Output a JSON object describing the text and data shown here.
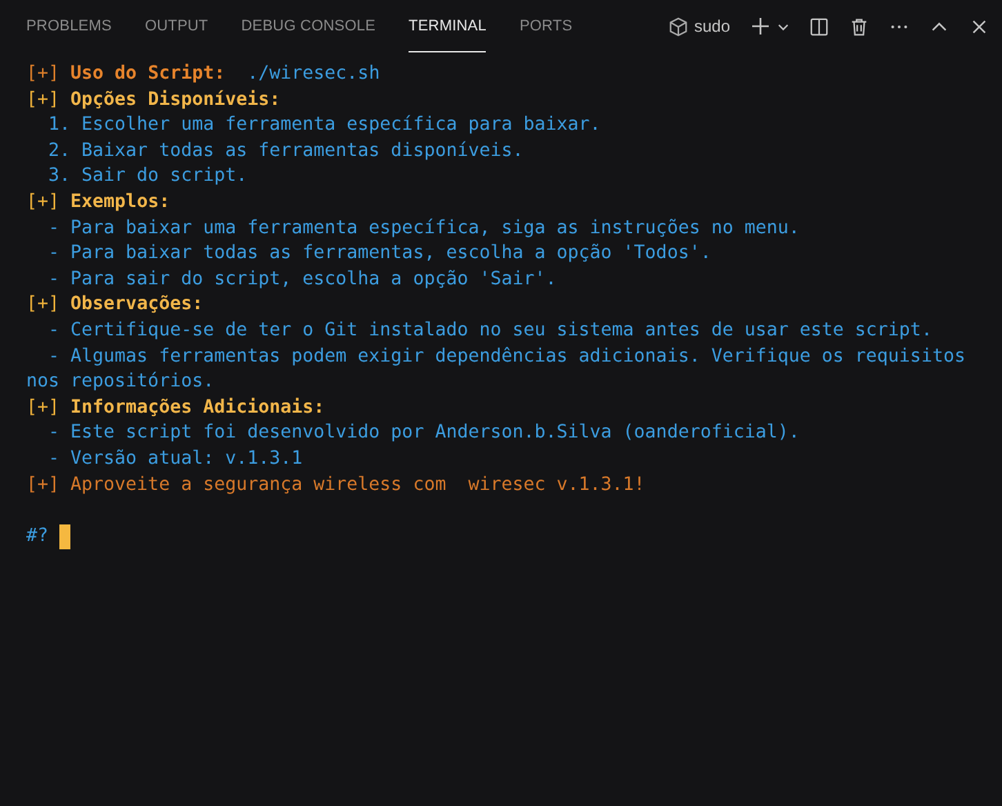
{
  "tabs": [
    {
      "label": "PROBLEMS",
      "selected": false
    },
    {
      "label": "OUTPUT",
      "selected": false
    },
    {
      "label": "DEBUG CONSOLE",
      "selected": false
    },
    {
      "label": "TERMINAL",
      "selected": true
    },
    {
      "label": "PORTS",
      "selected": false
    }
  ],
  "terminal_instance": {
    "name": "sudo"
  },
  "terminal": {
    "lines": [
      {
        "segments": [
          {
            "text": "[+] ",
            "kind": "marker-orange"
          },
          {
            "text": "Uso do Script: ",
            "kind": "title"
          },
          {
            "text": " ./wiresec.sh",
            "kind": "body"
          }
        ]
      },
      {
        "segments": [
          {
            "text": "[+] ",
            "kind": "marker"
          },
          {
            "text": "Opções Disponíveis:",
            "kind": "heading"
          }
        ]
      },
      {
        "segments": [
          {
            "text": "  1. Escolher uma ferramenta específica para baixar.",
            "kind": "body"
          }
        ]
      },
      {
        "segments": [
          {
            "text": "  2. Baixar todas as ferramentas disponíveis.",
            "kind": "body"
          }
        ]
      },
      {
        "segments": [
          {
            "text": "  3. Sair do script.",
            "kind": "body"
          }
        ]
      },
      {
        "segments": [
          {
            "text": "[+] ",
            "kind": "marker"
          },
          {
            "text": "Exemplos:",
            "kind": "heading"
          }
        ]
      },
      {
        "segments": [
          {
            "text": "  - Para baixar uma ferramenta específica, siga as instruções no menu.",
            "kind": "body"
          }
        ]
      },
      {
        "segments": [
          {
            "text": "  - Para baixar todas as ferramentas, escolha a opção 'Todos'.",
            "kind": "body"
          }
        ]
      },
      {
        "segments": [
          {
            "text": "  - Para sair do script, escolha a opção 'Sair'.",
            "kind": "body"
          }
        ]
      },
      {
        "segments": [
          {
            "text": "[+] ",
            "kind": "marker"
          },
          {
            "text": "Observações:",
            "kind": "heading"
          }
        ]
      },
      {
        "segments": [
          {
            "text": "  - Certifique-se de ter o Git instalado no seu sistema antes de usar este script.",
            "kind": "body"
          }
        ]
      },
      {
        "segments": [
          {
            "text": "  - Algumas ferramentas podem exigir dependências adicionais. Verifique os requisitos",
            "kind": "body"
          }
        ]
      },
      {
        "segments": [
          {
            "text": "nos repositórios.",
            "kind": "body"
          }
        ]
      },
      {
        "segments": [
          {
            "text": "[+] ",
            "kind": "marker"
          },
          {
            "text": "Informações Adicionais:",
            "kind": "heading"
          }
        ]
      },
      {
        "segments": [
          {
            "text": "  - Este script foi desenvolvido por Anderson.b.Silva (oanderoficial).",
            "kind": "body"
          }
        ]
      },
      {
        "segments": [
          {
            "text": "  - Versão atual: v.1.3.1",
            "kind": "body"
          }
        ]
      },
      {
        "segments": [
          {
            "text": "[+] Aproveite a segurança wireless com  wiresec v.1.3.1!",
            "kind": "highlight"
          }
        ]
      }
    ],
    "prompt": "#?"
  }
}
